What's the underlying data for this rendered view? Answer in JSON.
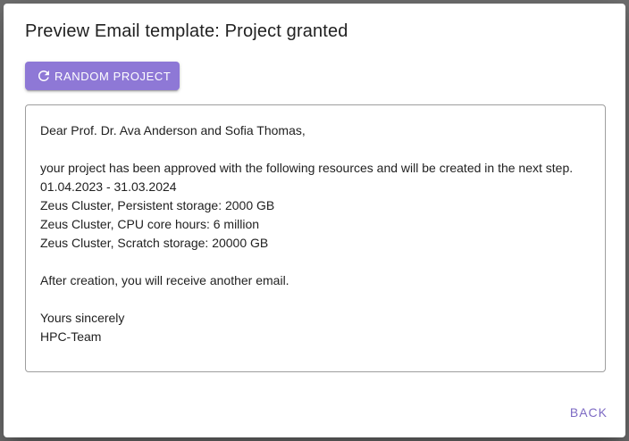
{
  "dialog": {
    "title": "Preview Email template: Project granted",
    "random_button_label": "Random Project",
    "random_button_icon": "refresh-icon",
    "back_button_label": "Back"
  },
  "email": {
    "greeting": "Dear Prof. Dr. Ava Anderson and Sofia Thomas,",
    "blank1": "",
    "intro": "your project has been approved with the following resources and will be created in the next step.",
    "period": "01.04.2023 - 31.03.2024",
    "resource1": "Zeus Cluster, Persistent storage: 2000 GB",
    "resource2": "Zeus Cluster, CPU core hours: 6 million",
    "resource3": "Zeus Cluster, Scratch storage: 20000 GB",
    "blank2": "",
    "followup": "After creation, you will receive another email.",
    "blank3": "",
    "closing": "Yours sincerely",
    "signature": "HPC-Team"
  },
  "colors": {
    "accent": "#8e78d6",
    "accent_text": "#7e6bc4",
    "backdrop": "#6f6f6f"
  }
}
